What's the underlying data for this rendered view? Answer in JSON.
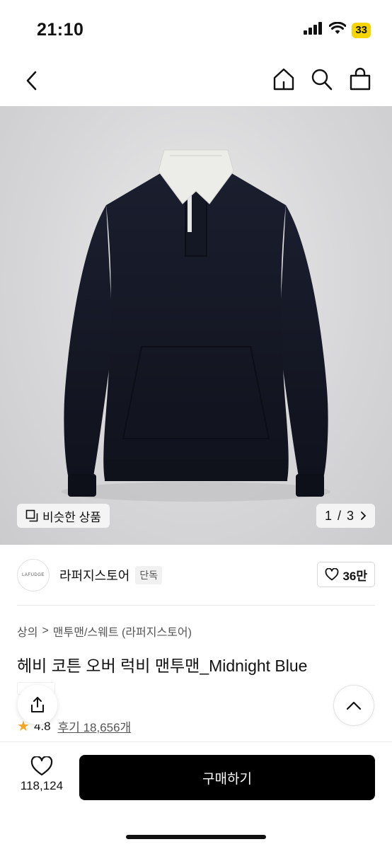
{
  "status_bar": {
    "time": "21:10",
    "battery": "33"
  },
  "nav": {
    "icons": [
      "back-chevron-icon",
      "home-icon",
      "search-icon",
      "shopping-bag-icon"
    ]
  },
  "gallery": {
    "similar_label": "비슷한 상품",
    "page_current": "1",
    "page_sep": "/",
    "page_total": "3"
  },
  "store": {
    "logo_text": "LAFUDGE",
    "name": "라퍼지스토어",
    "badge": "단독",
    "likes": "36만"
  },
  "breadcrumb": {
    "items": [
      "상의",
      "맨투맨/스웨트 (라퍼지스토어)"
    ],
    "separator": ">"
  },
  "product": {
    "title": "헤비 코튼 오버 럭비 맨투맨_Midnight Blue",
    "rating": "4.8",
    "review_label": "후기 18,656개"
  },
  "bottom": {
    "wish_count": "118,124",
    "buy_label": "구매하기"
  },
  "colors": {
    "accent": "#000000",
    "star": "#f5a623",
    "battery": "#f5d400",
    "hero_bg": "#d6d6d8",
    "garment": "#171a28"
  }
}
